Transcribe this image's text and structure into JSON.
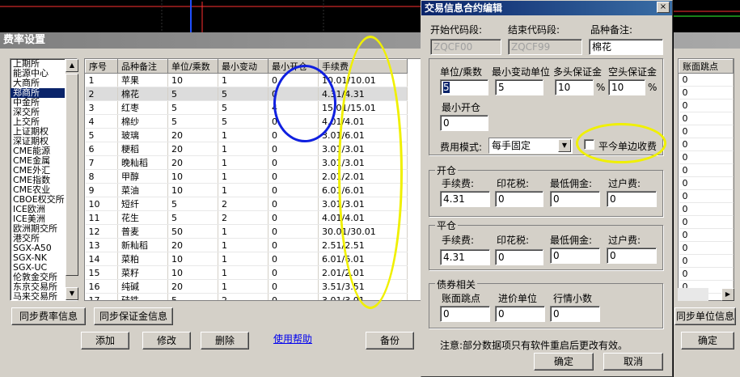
{
  "main_window": {
    "title": "费率设置",
    "exchanges": [
      "上期所",
      "能源中心",
      "大商所",
      "郑商所",
      "中金所",
      "深交所",
      "上交所",
      "上证期权",
      "深证期权",
      "CME能源",
      "CME金属",
      "CME外汇",
      "CME指数",
      "CME农业",
      "CBOE权交所",
      "ICE欧洲",
      "ICE美洲",
      "欧洲期交所",
      "港交所",
      "SGX-A50",
      "SGX-NK",
      "SGX-UC",
      "伦敦金交所",
      "东京交易所",
      "马来交易所"
    ],
    "selected_exchange_index": 3,
    "columns": [
      "序号",
      "品种备注",
      "单位/乘数",
      "最小变动",
      "最小开仓",
      "手续费"
    ],
    "rows": [
      [
        "1",
        "苹果",
        "10",
        "1",
        "0",
        "10.01/10.01"
      ],
      [
        "2",
        "棉花",
        "5",
        "5",
        "0",
        "4.31/4.31"
      ],
      [
        "3",
        "红枣",
        "5",
        "5",
        "4",
        "15.01/15.01"
      ],
      [
        "4",
        "棉纱",
        "5",
        "5",
        "0",
        "4.01/4.01"
      ],
      [
        "5",
        "玻璃",
        "20",
        "1",
        "0",
        "3.01/6.01"
      ],
      [
        "6",
        "粳稻",
        "20",
        "1",
        "0",
        "3.01/3.01"
      ],
      [
        "7",
        "晚籼稻",
        "20",
        "1",
        "0",
        "3.01/3.01"
      ],
      [
        "8",
        "甲醇",
        "10",
        "1",
        "0",
        "2.01/2.01"
      ],
      [
        "9",
        "菜油",
        "10",
        "1",
        "0",
        "6.01/6.01"
      ],
      [
        "10",
        "短纤",
        "5",
        "2",
        "0",
        "3.01/3.01"
      ],
      [
        "11",
        "花生",
        "5",
        "2",
        "0",
        "4.01/4.01"
      ],
      [
        "12",
        "普麦",
        "50",
        "1",
        "0",
        "30.01/30.01"
      ],
      [
        "13",
        "新籼稻",
        "20",
        "1",
        "0",
        "2.51/2.51"
      ],
      [
        "14",
        "菜粕",
        "10",
        "1",
        "0",
        "6.01/6.01"
      ],
      [
        "15",
        "菜籽",
        "10",
        "1",
        "0",
        "2.01/2.01"
      ],
      [
        "16",
        "纯碱",
        "20",
        "1",
        "0",
        "3.51/3.51"
      ],
      [
        "17",
        "硅铁",
        "5",
        "2",
        "0",
        "3.01/3.01"
      ]
    ],
    "selected_row_index": 1,
    "right_column_header": "账面跳点",
    "right_column_values": [
      "0",
      "0",
      "0",
      "0",
      "0",
      "0",
      "0",
      "0",
      "0",
      "0",
      "0",
      "0",
      "0",
      "0",
      "0",
      "0",
      "0"
    ],
    "buttons": {
      "sync_fee": "同步费率信息",
      "sync_margin": "同步保证金信息",
      "add": "添加",
      "modify": "修改",
      "delete": "删除",
      "help": "使用帮助",
      "backup": "备份",
      "sync_unit": "同步单位信息",
      "ok": "确定"
    }
  },
  "dialog": {
    "title": "交易信息合约编辑",
    "close_glyph": "×",
    "start_code_label": "开始代码段:",
    "end_code_label": "结束代码段:",
    "remark_label": "品种备注:",
    "start_code": "ZQCF00",
    "end_code": "ZQCF99",
    "remark": "棉花",
    "unit_label": "单位/乘数",
    "min_tick_label": "最小变动单位",
    "long_margin_label": "多头保证金",
    "short_margin_label": "空头保证金",
    "unit": "5",
    "min_tick": "5",
    "long_margin": "10",
    "short_margin": "10",
    "percent": "%",
    "min_open_label": "最小开仓",
    "min_open": "0",
    "fee_mode_label": "费用模式:",
    "fee_mode": "每手固定",
    "close_today_single_label": "平今单边收费",
    "open_group_label": "开仓",
    "close_group_label": "平仓",
    "fee_label": "手续费:",
    "stamp_label": "印花税:",
    "min_comm_label": "最低佣金:",
    "transfer_label": "过户费:",
    "open_fee": "4.31",
    "open_stamp": "0",
    "open_min_comm": "0",
    "open_transfer": "0",
    "close_fee": "4.31",
    "close_stamp": "0",
    "close_min_comm": "0",
    "close_transfer": "0",
    "bond_group_label": "债券相关",
    "book_tick_label": "账面跳点",
    "price_unit_label": "进价单位",
    "quote_decimals_label": "行情小数",
    "book_tick": "0",
    "price_unit": "0",
    "quote_decimals": "0",
    "note": "注意:部分数据项只有软件重启后更改有效。",
    "ok": "确定",
    "cancel": "取消"
  },
  "annotations": {
    "blue": "#1020e0",
    "yellow": "#f0f000"
  }
}
